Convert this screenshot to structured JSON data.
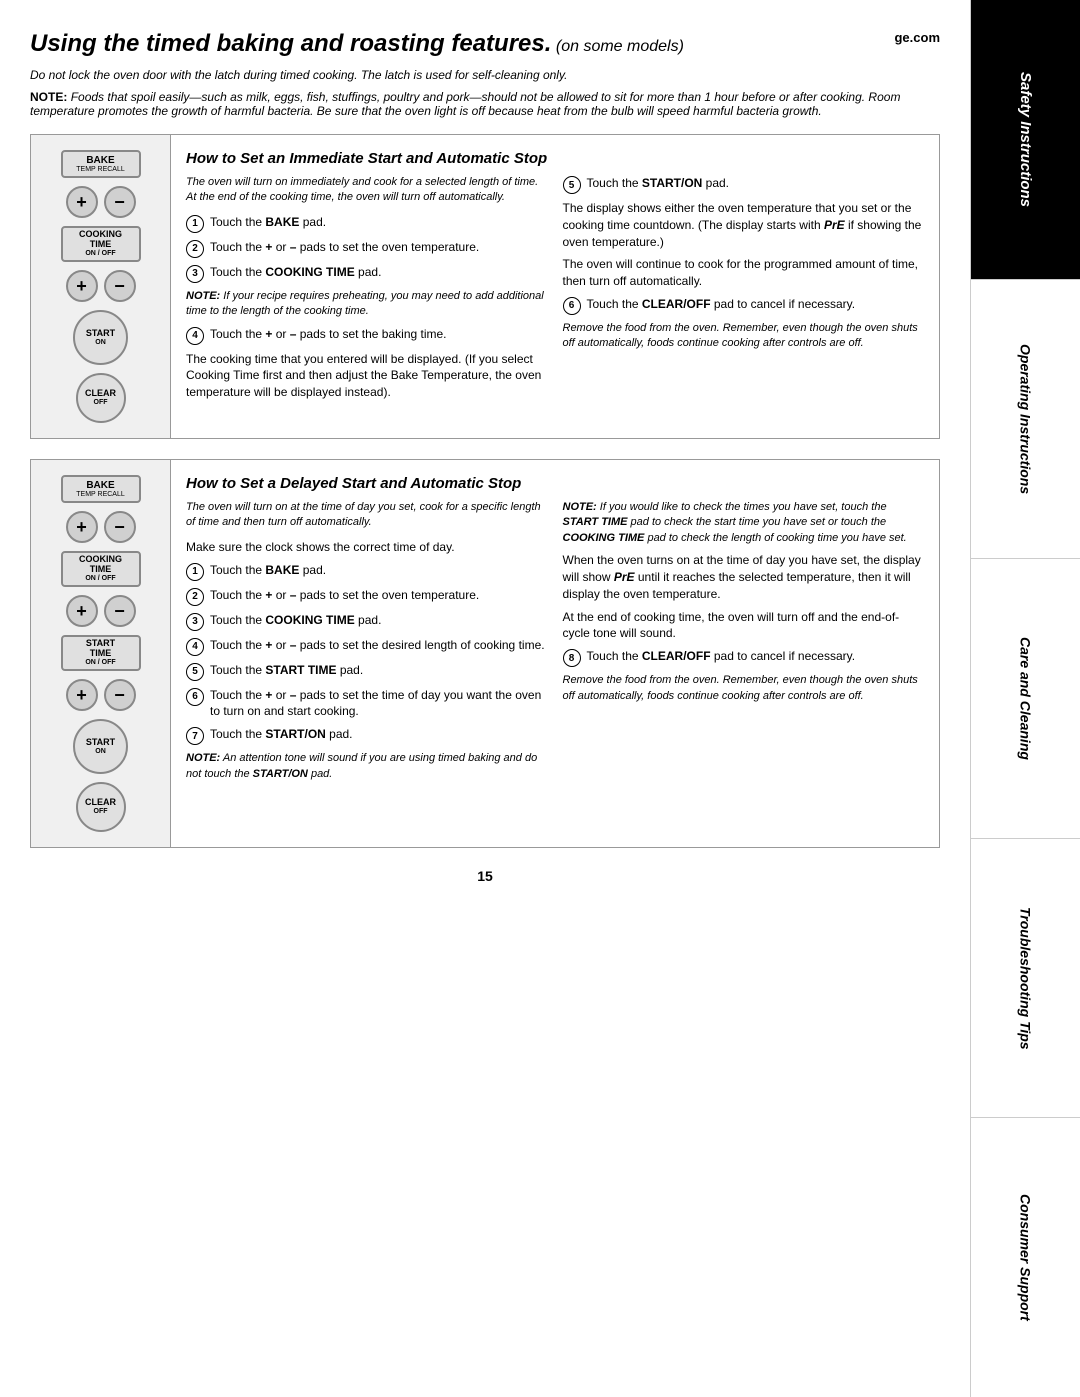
{
  "page": {
    "title": "Using the timed baking and roasting features.",
    "subtitle": "(on some models)",
    "ge_com": "ge.com",
    "page_number": "15"
  },
  "sidebar": {
    "sections": [
      {
        "label": "Safety Instructions",
        "style": "safety"
      },
      {
        "label": "Operating Instructions",
        "style": "operating"
      },
      {
        "label": "Care and Cleaning",
        "style": "care"
      },
      {
        "label": "Troubleshooting Tips",
        "style": "troubleshooting"
      },
      {
        "label": "Consumer Support",
        "style": "consumer"
      }
    ]
  },
  "warnings": {
    "door_warning": "Do not lock the oven door with the latch during timed cooking. The latch is used for self-cleaning only.",
    "note_label": "NOTE:",
    "note_text": "Foods that spoil easily—such as milk, eggs, fish, stuffings, poultry and pork—should not be allowed to sit for more than 1 hour before or after cooking. Room temperature promotes the growth of harmful bacteria. Be sure that the oven light is off because heat from the bulb will speed harmful bacteria growth."
  },
  "section1": {
    "heading": "How to Set an Immediate Start and Automatic Stop",
    "intro": "The oven will turn on immediately and cook for a selected length of time. At the end of the cooking time, the oven will turn off automatically.",
    "steps": [
      {
        "num": "1",
        "text": "Touch the BAKE pad."
      },
      {
        "num": "2",
        "text": "Touch the + or – pads to set the oven temperature."
      },
      {
        "num": "3",
        "text": "Touch the COOKING TIME pad."
      },
      {
        "num": "4",
        "text": "Touch the + or – pads to set the baking time."
      }
    ],
    "note_inline": "NOTE: If your recipe requires preheating, you may need to add additional time to the length of the cooking time.",
    "body_text1": "The cooking time that you entered will be displayed. (If you select Cooking Time first and then adjust the Bake Temperature, the oven temperature will be displayed instead).",
    "steps_right": [
      {
        "num": "5",
        "text": "Touch the START/ON pad."
      }
    ],
    "display_text": "The display shows either the oven temperature that you set or the cooking time countdown. (The display starts with PrE if showing the oven temperature.)",
    "continue_text": "The oven will continue to cook for the programmed amount of time, then turn off automatically.",
    "step6": {
      "num": "6",
      "text": "Touch the CLEAR/OFF pad to cancel if necessary."
    },
    "remove_text": "Remove the food from the oven. Remember, even though the oven shuts off automatically, foods continue cooking after controls are off."
  },
  "section2": {
    "heading": "How to Set a Delayed Start and Automatic Stop",
    "intro": "The oven will turn on at the time of day you set, cook for a specific length of time and then turn off automatically.",
    "make_sure": "Make sure the clock shows the correct time of day.",
    "steps_left": [
      {
        "num": "1",
        "text": "Touch the BAKE pad."
      },
      {
        "num": "2",
        "text": "Touch the + or – pads to set the oven temperature."
      },
      {
        "num": "3",
        "text": "Touch the COOKING TIME pad."
      },
      {
        "num": "4",
        "text": "Touch the + or – pads to set the desired length of cooking time."
      },
      {
        "num": "5",
        "text": "Touch the START TIME pad."
      },
      {
        "num": "6",
        "text": "Touch the + or – pads to set the time of day you want the oven to turn on and start cooking."
      },
      {
        "num": "7",
        "text": "Touch the START/ON pad."
      }
    ],
    "note_bottom": "NOTE: An attention tone will sound if you are using timed baking and do not touch the START/ON pad.",
    "steps_right": [
      {
        "num": "8",
        "text": "Touch the CLEAR/OFF pad to cancel if necessary."
      }
    ],
    "note_right": "NOTE: If you would like to check the times you have set, touch the START TIME pad to check the start time you have set or touch the COOKING TIME pad to check the length of cooking time you have set.",
    "when_text": "When the oven turns on at the time of day you have set, the display will show PrE until it reaches the selected temperature, then it will display the oven temperature.",
    "end_text": "At the end of cooking time, the oven will turn off and the end-of-cycle tone will sound.",
    "remove_text": "Remove the food from the oven. Remember, even though the oven shuts off automatically, foods continue cooking after controls are off."
  },
  "controls": {
    "bake_label": "BAKE",
    "temp_recall": "TEMP RECALL",
    "cooking_time": "COOKING TIME",
    "on_off": "ON / OFF",
    "start_on": "START ON",
    "clear_off": "CLEAR OFF",
    "start_time": "START TIME",
    "plus": "+",
    "minus": "−"
  }
}
